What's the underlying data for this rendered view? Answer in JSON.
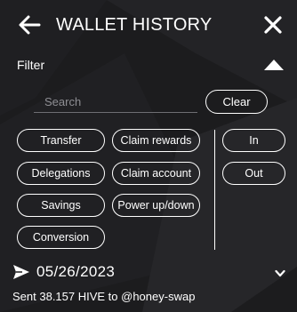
{
  "header": {
    "title": "WALLET HISTORY",
    "back_icon": "arrow-left-icon",
    "close_icon": "close-icon"
  },
  "filter": {
    "label": "Filter",
    "toggle_icon": "caret-up-icon",
    "search_placeholder": "Search",
    "search_value": "",
    "clear_label": "Clear",
    "types": {
      "transfer": "Transfer",
      "claim_rewards": "Claim rewards",
      "delegations": "Delegations",
      "claim_account": "Claim account",
      "savings": "Savings",
      "power": "Power up/down",
      "conversion": "Conversion"
    },
    "direction": {
      "in": "In",
      "out": "Out"
    }
  },
  "transactions": [
    {
      "icon": "send-icon",
      "date": "05/26/2023",
      "description": "Sent 38.157 HIVE to @honey-swap",
      "expand_icon": "chevron-down-icon"
    }
  ],
  "colors": {
    "background": "#1c1c1e",
    "text": "#ffffff",
    "muted": "#8e8e93"
  }
}
